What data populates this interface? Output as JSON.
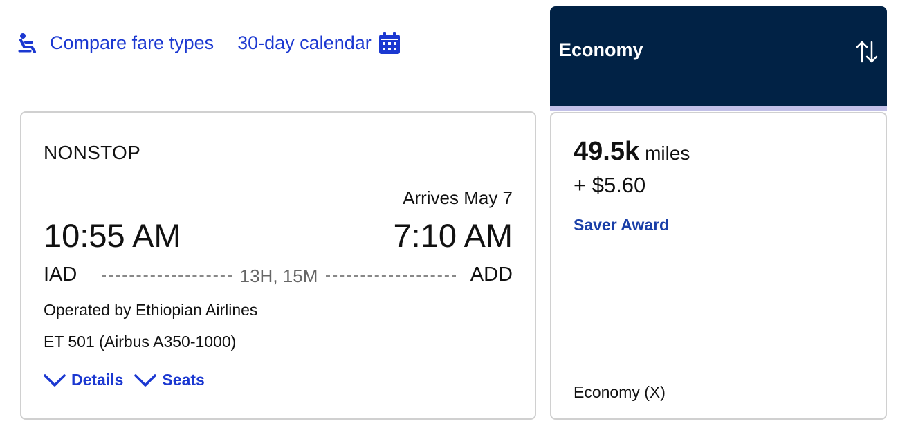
{
  "top_links": {
    "compare_label": "Compare fare types",
    "calendar_label": "30-day calendar"
  },
  "flight": {
    "stops": "NONSTOP",
    "arrives_note": "Arrives May 7",
    "depart_time": "10:55 AM",
    "arrive_time": "7:10 AM",
    "origin": "IAD",
    "destination": "ADD",
    "duration": "13H, 15M",
    "operator": "Operated by Ethiopian Airlines",
    "flight_number": "ET 501 (Airbus A350-1000)",
    "details_label": "Details",
    "seats_label": "Seats"
  },
  "fare_column": {
    "title": "Economy"
  },
  "fare": {
    "miles": "49.5k",
    "miles_unit": "miles",
    "fee": "+ $5.60",
    "award_type": "Saver Award",
    "cabin": "Economy (X)"
  },
  "colors": {
    "link_blue": "#1b38d1",
    "header_navy": "#012245",
    "header_band": "#c2c0e8",
    "award_blue": "#1a3fa8"
  },
  "icons": {
    "compare": "seat-icon",
    "calendar": "calendar-icon",
    "sort": "sort-arrows-icon",
    "expand": "chevron-down-icon"
  }
}
